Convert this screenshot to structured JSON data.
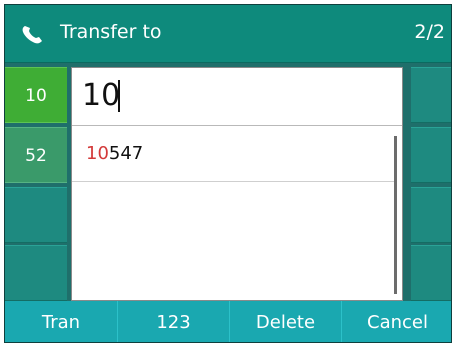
{
  "title_bar": {
    "icon": "phone-icon",
    "title": "Transfer to",
    "page_indicator": "2/2"
  },
  "line_keys": {
    "left": [
      {
        "label": "10",
        "state": "active"
      },
      {
        "label": "52",
        "state": "normal"
      },
      {
        "label": "",
        "state": "empty"
      },
      {
        "label": "",
        "state": "empty"
      }
    ]
  },
  "dialog": {
    "input_value": "10",
    "results": [
      {
        "match": "10",
        "rest": "547"
      }
    ]
  },
  "softkeys": [
    {
      "label": "Tran"
    },
    {
      "label": "123"
    },
    {
      "label": "Delete"
    },
    {
      "label": "Cancel"
    }
  ],
  "colors": {
    "title_bar": "#0e8a7c",
    "active_line": "#3fad35",
    "softkey_bar": "#1aa8b0",
    "match_highlight": "#d33a3a"
  }
}
